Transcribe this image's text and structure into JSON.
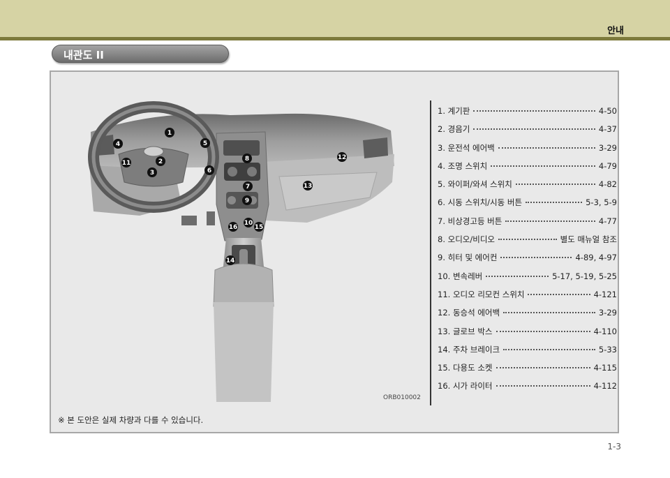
{
  "header": {
    "section": "안내",
    "title": "내관도 II"
  },
  "figure": {
    "code": "ORB010002",
    "callouts": [
      "1",
      "2",
      "3",
      "4",
      "5",
      "6",
      "7",
      "8",
      "9",
      "10",
      "11",
      "12",
      "13",
      "14",
      "15",
      "16"
    ]
  },
  "index": [
    {
      "label": "1. 계기판",
      "page": "4-50"
    },
    {
      "label": "2. 경음기",
      "page": "4-37"
    },
    {
      "label": "3. 운전석 에어백",
      "page": "3-29"
    },
    {
      "label": "4. 조명 스위치",
      "page": "4-79"
    },
    {
      "label": "5. 와이퍼/와셔 스위치",
      "page": "4-82"
    },
    {
      "label": "6. 시동 스위치/시동 버튼",
      "page": "5-3, 5-9"
    },
    {
      "label": "7. 비상경고등 버튼",
      "page": "4-77"
    },
    {
      "label": "8. 오디오/비디오",
      "page": "별도 매뉴얼 참조"
    },
    {
      "label": "9. 히터 및 에어컨",
      "page": "4-89, 4-97"
    },
    {
      "label": "10. 변속레버",
      "page": "5-17, 5-19, 5-25"
    },
    {
      "label": "11. 오디오 리모컨 스위치",
      "page": "4-121"
    },
    {
      "label": "12. 동승석 에어백",
      "page": "3-29"
    },
    {
      "label": "13. 글로브 박스",
      "page": "4-110"
    },
    {
      "label": "14. 주차 브레이크",
      "page": "5-33"
    },
    {
      "label": "15. 다용도 소켓",
      "page": "4-115"
    },
    {
      "label": "16. 시가 라이터",
      "page": "4-112"
    }
  ],
  "note": "※ 본 도안은 실제 차량과 다를 수 있습니다.",
  "page_number": "1-3",
  "colors": {
    "header_band": "#d6d3a4",
    "header_rule": "#7d7a3c",
    "title_pill": "#8a8a8a",
    "panel_bg": "#e9e9e9",
    "callout": "#111111"
  }
}
